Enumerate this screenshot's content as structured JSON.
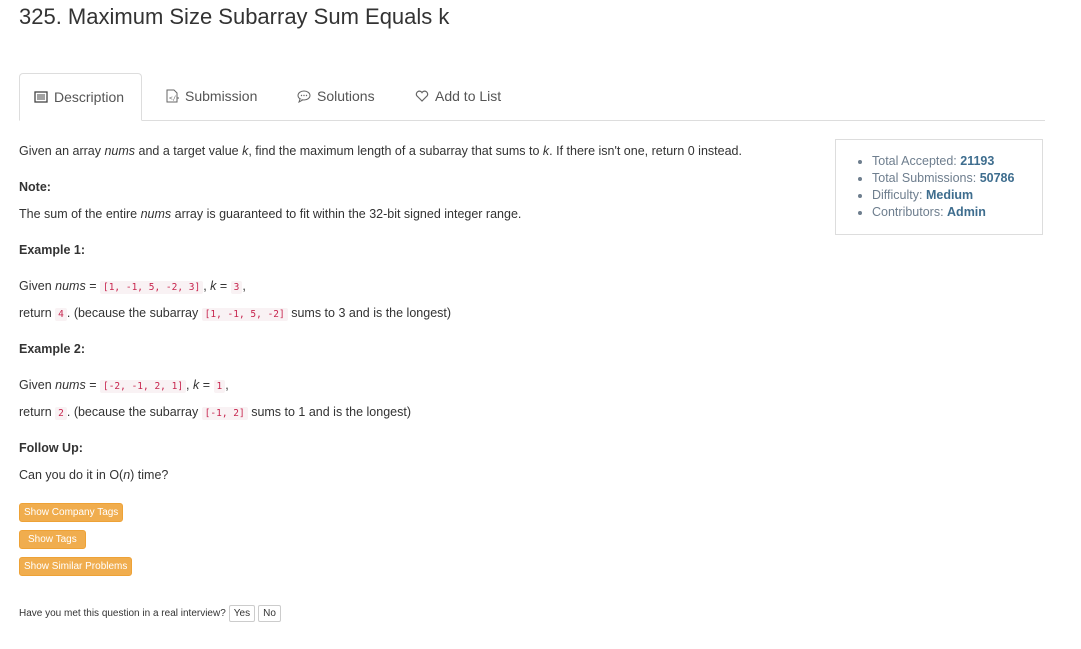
{
  "problem": {
    "title": "325. Maximum Size Subarray Sum Equals k"
  },
  "tabs": [
    {
      "label": "Description",
      "icon": "description-icon",
      "active": true
    },
    {
      "label": "Submission",
      "icon": "code-file-icon"
    },
    {
      "label": "Solutions",
      "icon": "chat-bubble-icon"
    },
    {
      "label": "Add to List",
      "icon": "heart-icon"
    }
  ],
  "description": {
    "intro_1": "Given an array ",
    "intro_nums": "nums",
    "intro_2": " and a target value ",
    "intro_k": "k",
    "intro_3": ", find the maximum length of a subarray that sums to ",
    "intro_k2": "k",
    "intro_4": ". If there isn't one, return 0 instead.",
    "note_label": "Note:",
    "note_1": "The sum of the entire ",
    "note_nums": "nums",
    "note_2": " array is guaranteed to fit within the 32-bit signed integer range.",
    "example1_label": "Example 1:",
    "example1": {
      "given": "Given ",
      "nums": "nums",
      "eq": " = ",
      "array": "[1, -1, 5, -2, 3]",
      "comma": ", ",
      "k": "k",
      "keq": " = ",
      "kval": "3",
      "end": ",",
      "ret": "return ",
      "ret_val": "4",
      "because": ". (because the subarray ",
      "sub": "[1, -1, 5, -2]",
      "tail": " sums to 3 and is the longest)"
    },
    "example2_label": "Example 2:",
    "example2": {
      "given": "Given ",
      "nums": "nums",
      "eq": " = ",
      "array": "[-2, -1, 2, 1]",
      "comma": ", ",
      "k": "k",
      "keq": " = ",
      "kval": "1",
      "end": ",",
      "ret": "return ",
      "ret_val": "2",
      "because": ". (because the subarray ",
      "sub": "[-1, 2]",
      "tail": " sums to 1 and is the longest)"
    },
    "followup_label": "Follow Up:",
    "followup_1": "Can you do it in O(",
    "followup_n": "n",
    "followup_2": ") time?"
  },
  "stats": {
    "accepted_label": "Total Accepted: ",
    "accepted_value": "21193",
    "submissions_label": "Total Submissions: ",
    "submissions_value": "50786",
    "difficulty_label": "Difficulty: ",
    "difficulty_value": "Medium",
    "contributors_label": "Contributors: ",
    "contributors_value": "Admin"
  },
  "buttons": {
    "company_tags": "Show Company Tags",
    "tags": "Show Tags",
    "similar": "Show Similar Problems"
  },
  "interview": {
    "question": "Have you met this question in a real interview?",
    "yes": "Yes",
    "no": "No"
  },
  "colors": {
    "accent": "#f0ad4e",
    "stat_value": "#3e6d8e",
    "code": "#c7254e"
  }
}
